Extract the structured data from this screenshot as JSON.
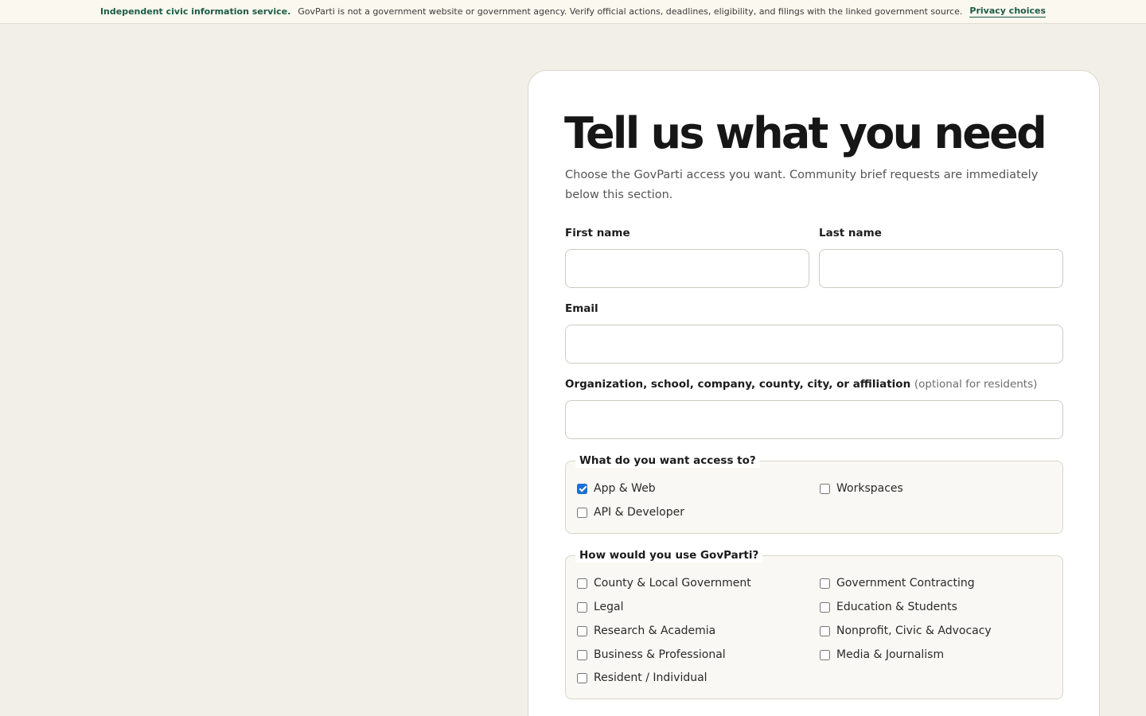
{
  "banner": {
    "strong": "Independent civic information service.",
    "text": "GovParti is not a government website or government agency. Verify official actions, deadlines, eligibility, and filings with the linked government source.",
    "link": "Privacy choices"
  },
  "form": {
    "title": "Tell us what you need",
    "subtitle": "Choose the GovParti access you want. Community brief requests are immediately below this section.",
    "first_name": {
      "label": "First name",
      "value": ""
    },
    "last_name": {
      "label": "Last name",
      "value": ""
    },
    "email": {
      "label": "Email",
      "value": ""
    },
    "organization": {
      "label": "Organization, school, company, county, city, or affiliation",
      "optional": "(optional for residents)",
      "value": ""
    },
    "access": {
      "legend": "What do you want access to?",
      "options": [
        {
          "label": "App & Web",
          "checked": true
        },
        {
          "label": "Workspaces",
          "checked": false
        },
        {
          "label": "API & Developer",
          "checked": false
        }
      ]
    },
    "usage": {
      "legend": "How would you use GovParti?",
      "options": [
        {
          "label": "County & Local Government",
          "checked": false
        },
        {
          "label": "Government Contracting",
          "checked": false
        },
        {
          "label": "Legal",
          "checked": false
        },
        {
          "label": "Education & Students",
          "checked": false
        },
        {
          "label": "Research & Academia",
          "checked": false
        },
        {
          "label": "Nonprofit, Civic & Advocacy",
          "checked": false
        },
        {
          "label": "Business & Professional",
          "checked": false
        },
        {
          "label": "Media & Journalism",
          "checked": false
        },
        {
          "label": "Resident / Individual",
          "checked": false
        }
      ]
    }
  }
}
